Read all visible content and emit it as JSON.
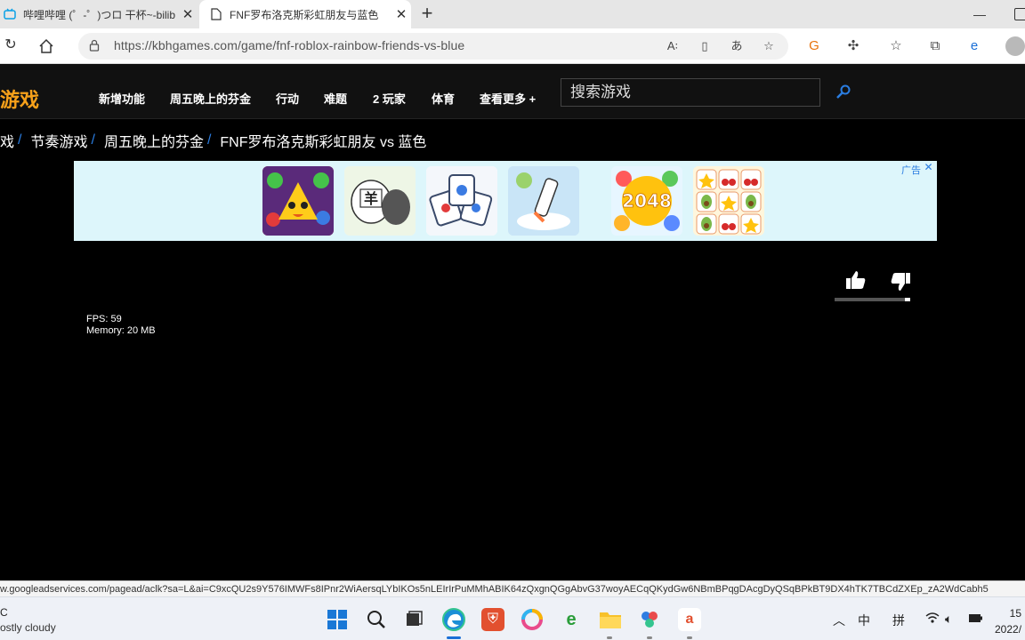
{
  "browser": {
    "tabs": [
      {
        "title": "哔哩哔哩 (゜-゜)つロ 干杯~-bilib",
        "icon": "bilibili-icon",
        "active": false
      },
      {
        "title": "FNF罗布洛克斯彩虹朋友与蓝色",
        "icon": "page-icon",
        "active": true
      }
    ],
    "new_tab": "+",
    "url": "https://kbhgames.com/game/fnf-roblox-rainbow-friends-vs-blue"
  },
  "site": {
    "logo": "游戏",
    "nav": [
      "新增功能",
      "周五晚上的芬金",
      "行动",
      "难题",
      "2 玩家",
      "体育",
      "查看更多 +"
    ],
    "search_placeholder": "搜索游戏"
  },
  "breadcrumb": [
    "戏",
    "节奏游戏",
    "周五晚上的芬金",
    "FNF罗布洛克斯彩虹朋友 vs 蓝色"
  ],
  "ad": {
    "label": "广告",
    "games": [
      "bird-game",
      "sheep-game",
      "mahjong-game",
      "pencil-game",
      "2048",
      "fruit-match-game"
    ],
    "game_2048_label": "2048",
    "sheep_label": "羊"
  },
  "game": {
    "fps": "FPS: 59",
    "memory": "Memory: 20 MB",
    "rating_fraction": 0.93
  },
  "status_url": "w.googleadservices.com/pagead/aclk?sa=L&ai=C9xcQU2s9Y576IMWFs8IPnr2WiAersqLYbIKOs5nLEIrIrPuMMhABIK64zQxgnQGgAbvG37woyAECqQKydGw6NBmBPqgDAcgDyQSqBPkBT9DX4hTK7TBCdZXEp_zA2WdCabh5",
  "taskbar": {
    "weather_temp": "C",
    "weather_desc": "ostly cloudy",
    "ime_1": "中",
    "ime_2": "拼",
    "time": "15",
    "date": "2022/"
  }
}
